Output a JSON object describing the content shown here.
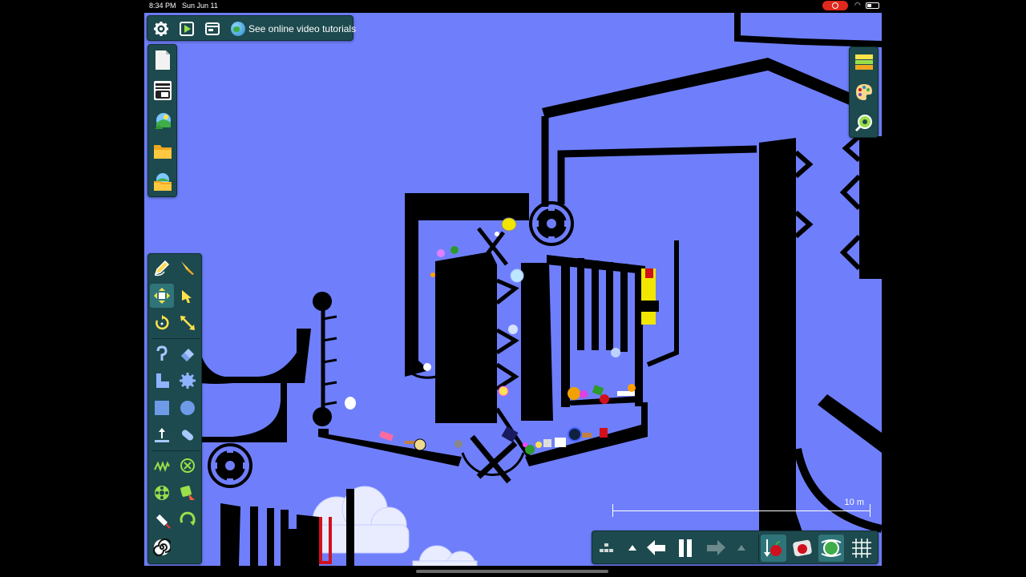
{
  "status_bar": {
    "time": "8:34 PM",
    "date": "Sun Jun 11"
  },
  "top_toolbar": {
    "tutorials_link": "See online video tutorials",
    "icons": [
      "settings-gear-icon",
      "play-icon",
      "window-icon",
      "globe-icon"
    ]
  },
  "file_panel": {
    "icons": [
      "new-document-icon",
      "scene-list-icon",
      "landscape-share-icon",
      "open-folder-icon",
      "folder-landscape-icon"
    ]
  },
  "tools_panel": {
    "icons": [
      "pencil-draw-icon",
      "knife-cut-icon",
      "move-tool-icon",
      "drag-hand-icon",
      "rotate-tool-icon",
      "resize-tool-icon",
      "rope-chain-icon",
      "eraser-icon",
      "curve-shape-icon",
      "gear-shape-icon",
      "square-shape-icon",
      "circle-shape-icon",
      "fixate-tool-icon",
      "tracer-icon",
      "spring-icon",
      "hinge-icon",
      "wheel-icon",
      "thruster-icon",
      "laser-icon",
      "rotate-motor-icon",
      "spiral-icon"
    ],
    "selected": "move-tool-icon"
  },
  "right_panel": {
    "icons": [
      "background-layers-icon",
      "color-palette-icon",
      "zoom-icon"
    ]
  },
  "bottom_toolbar": {
    "icons": [
      "grid-options-icon",
      "expand-up-icon",
      "undo-icon",
      "pause-icon",
      "redo-icon",
      "expand-up-icon",
      "gravity-apple-icon",
      "air-friction-icon",
      "collision-toggle-icon",
      "grid-snap-icon"
    ]
  },
  "scale": {
    "label": "10 m"
  },
  "colors": {
    "canvas_bg": "#6f7ffb",
    "panel_bg": "#1d4a4e",
    "solid": "#000000",
    "cloud": "#e9ecff"
  }
}
